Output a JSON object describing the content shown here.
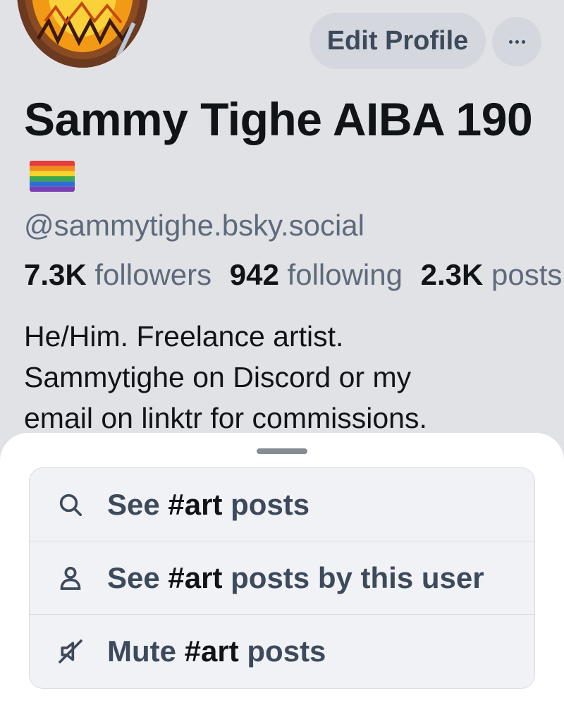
{
  "header": {
    "edit_profile_label": "Edit Profile",
    "more_icon": "ellipsis-icon"
  },
  "profile": {
    "display_name": "Sammy Tighe AIBA 190",
    "flag_icon": "rainbow-flag-emoji",
    "handle": "@sammytighe.bsky.social",
    "stats": {
      "followers_count": "7.3K",
      "followers_label": "followers",
      "following_count": "942",
      "following_label": "following",
      "posts_count": "2.3K",
      "posts_label": "posts"
    },
    "bio_lines": [
      "He/Him. Freelance artist.",
      "Sammytighe on Discord or my",
      "email on linktr for commissions."
    ]
  },
  "sheet": {
    "tag": "#art",
    "items": [
      {
        "icon": "search-icon",
        "prefix": "See",
        "suffix": "posts"
      },
      {
        "icon": "person-icon",
        "prefix": "See",
        "suffix": "posts by this user"
      },
      {
        "icon": "mute-icon",
        "prefix": "Mute",
        "suffix": "posts"
      }
    ]
  },
  "colors": {
    "background": "#e1e2e6",
    "sheet": "#ffffff",
    "menu_bg": "#f1f2f5",
    "text_primary": "#101418",
    "text_secondary": "#5e6a7b",
    "menu_text": "#3d4a5c"
  }
}
